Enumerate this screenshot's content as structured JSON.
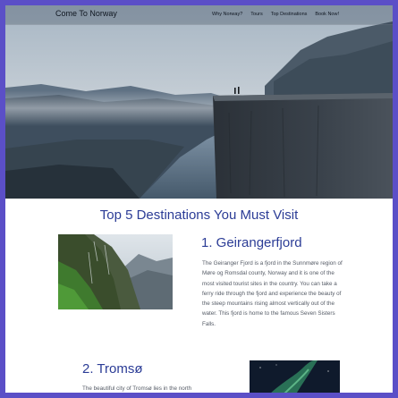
{
  "nav": {
    "brand": "Come To Norway",
    "links": [
      "Why Norway?",
      "Tours",
      "Top Destinations",
      "Book Now!"
    ]
  },
  "hero": {
    "image": "preikestolen-cliff-fjord-photo"
  },
  "section": {
    "title": "Top 5 Destinations You Must Visit"
  },
  "destinations": [
    {
      "title": "1. Geirangerfjord",
      "image": "geirangerfjord-mountain-photo",
      "description": "The Geiranger Fjord is a fjord in the Sunnmøre region of Møre og Romsdal county, Norway and it is one of the most visited tourist sites in the country. You can take a ferry ride through the fjord and experience the beauty of the steep mountains rising almost vertically out of the water. This fjord is home to the famous Seven Sisters Falls."
    },
    {
      "title": "2. Tromsø",
      "image": "tromso-northern-lights-photo",
      "description": "The beautiful city of Tromsø lies in the north"
    }
  ],
  "colors": {
    "frame": "#5b4fc7",
    "heading": "#2b3c96",
    "body_text": "#555b66"
  }
}
